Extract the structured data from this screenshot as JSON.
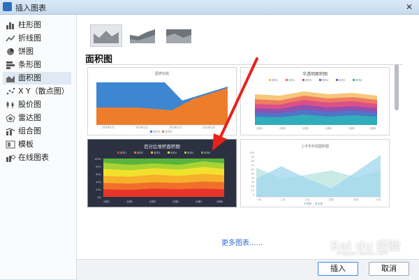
{
  "window": {
    "title": "插入图表",
    "close_glyph": "✕"
  },
  "sidebar": {
    "items": [
      {
        "label": "柱形图",
        "icon": "bar-chart-icon"
      },
      {
        "label": "折线图",
        "icon": "line-chart-icon"
      },
      {
        "label": "饼图",
        "icon": "pie-chart-icon"
      },
      {
        "label": "条形图",
        "icon": "horizontal-bar-icon"
      },
      {
        "label": "面积图",
        "icon": "area-chart-icon",
        "selected": true
      },
      {
        "label": "X Y（散点图）",
        "icon": "scatter-icon"
      },
      {
        "label": "股价图",
        "icon": "stock-chart-icon"
      },
      {
        "label": "雷达图",
        "icon": "radar-chart-icon"
      },
      {
        "label": "组合图",
        "icon": "combo-chart-icon"
      },
      {
        "label": "模板",
        "icon": "template-icon"
      },
      {
        "label": "在线图表",
        "icon": "online-chart-icon"
      }
    ]
  },
  "main": {
    "section_title": "面积图",
    "more_link": "更多图表......",
    "cards": [
      {
        "title": "图表标题",
        "legend": [
          "系列1",
          "系列2"
        ],
        "x_labels": [
          "2019/1/1",
          "2019/1/2",
          "2019/1/3",
          "2019/1/4"
        ]
      },
      {
        "title": "半透明面积图",
        "legend": [
          "系列1",
          "系列2",
          "系列3",
          "系列4",
          "系列5",
          "系列6"
        ],
        "x_labels": [
          "分类1",
          "分类2",
          "分类3",
          "分类4",
          "分类5",
          "分类6"
        ]
      },
      {
        "title": "百分比堆积面积图",
        "legend": [
          "系列1",
          "系列2",
          "系列3",
          "系列4",
          "系列5",
          "系列6"
        ],
        "y_labels": [
          "100%",
          "80%",
          "60%",
          "40%",
          "20%",
          "0%"
        ],
        "x_labels": [
          "分类1",
          "分类2",
          "分类3",
          "分类4",
          "分类5",
          "分类6"
        ]
      },
      {
        "title": "上半年利润图积图",
        "legend": [
          "预算",
          "实绩"
        ],
        "y_labels": [
          "100",
          "90",
          "80",
          "70",
          "60",
          "50",
          "40",
          "30",
          "20",
          "10",
          "0"
        ],
        "x_labels": [
          "一月",
          "二月",
          "三月",
          "四月",
          "五月",
          "六月"
        ]
      }
    ]
  },
  "buttons": {
    "insert": "插入",
    "cancel": "取消"
  },
  "watermark": {
    "text": "Bai du 经验",
    "sub": "jingyan.baidu.com"
  },
  "colors": {
    "accent": "#2c6fcf",
    "arrow": "#e8221b"
  }
}
